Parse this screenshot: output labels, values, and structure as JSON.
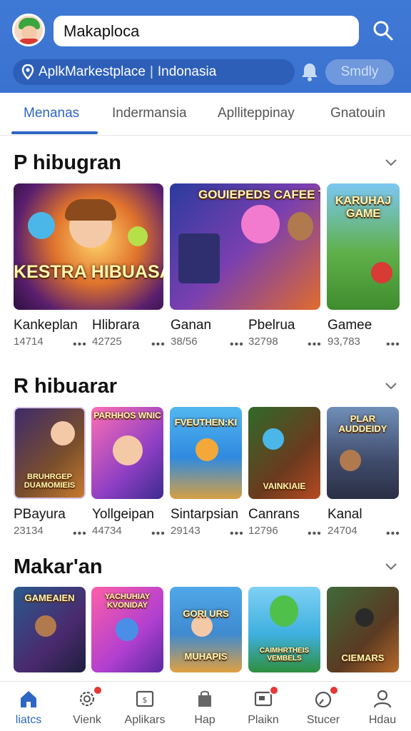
{
  "header": {
    "search_value": "Makaploca",
    "location_text": "AplkMarkestplace",
    "region_text": "Indonasia",
    "action_button": "Smdly",
    "colors": {
      "header_bg": "#3a72cf",
      "accent": "#2d66c4"
    }
  },
  "tabs": [
    {
      "label": "Menanas",
      "active": true
    },
    {
      "label": "Indermansia",
      "active": false
    },
    {
      "label": "Aplliteppinay",
      "active": false
    },
    {
      "label": "Gnatouin",
      "active": false
    }
  ],
  "sections": [
    {
      "title": "P hibugran",
      "cards": [
        {
          "name": "Kankeplan",
          "count": "14714",
          "art": "KESTRA HIBUASA"
        },
        {
          "name": "Hlibrara",
          "count": "42725",
          "art": ""
        },
        {
          "name": "Ganan",
          "count": "38/56",
          "art": "GOUIEPEDS CAFEE TAIONARN"
        },
        {
          "name": "Pbelrua",
          "count": "32798",
          "art": ""
        },
        {
          "name": "Gamee",
          "count": "93,783",
          "art": "KARUHAJ GAME"
        }
      ]
    },
    {
      "title": "R hibuarar",
      "cards": [
        {
          "name": "PBayura",
          "count": "23134",
          "art": "BRUHRGEP DUAMOMIEIS"
        },
        {
          "name": "Yollgeipan",
          "count": "44734",
          "art": "PARHHOS WNIC"
        },
        {
          "name": "Sintarpsian",
          "count": "29143",
          "art": "FVEUTHEN:KI"
        },
        {
          "name": "Canrans",
          "count": "12796",
          "art": "VAINKIAIE"
        },
        {
          "name": "Kanal",
          "count": "24704",
          "art": "PLAR AUDDEIDY"
        }
      ]
    },
    {
      "title": "Makar'an",
      "cards": [
        {
          "art": "GAMEAIEN"
        },
        {
          "art": "YACHUHIAY KVONIDAY"
        },
        {
          "art": "GORI URS MUHAPIS"
        },
        {
          "art": "CAIMHRTHEIS VEMBELS"
        },
        {
          "art": "CIEMARS"
        }
      ]
    }
  ],
  "bottom_nav": [
    {
      "label": "liatcs",
      "icon": "home-icon",
      "active": true,
      "badge": false
    },
    {
      "label": "Vienk",
      "icon": "gear-icon",
      "active": false,
      "badge": true
    },
    {
      "label": "Aplikars",
      "icon": "apps-box-icon",
      "active": false,
      "badge": false
    },
    {
      "label": "Hap",
      "icon": "bag-icon",
      "active": false,
      "badge": false
    },
    {
      "label": "Plaikn",
      "icon": "message-icon",
      "active": false,
      "badge": true
    },
    {
      "label": "Stucer",
      "icon": "gauge-icon",
      "active": false,
      "badge": true
    },
    {
      "label": "Hdau",
      "icon": "profile-icon",
      "active": false,
      "badge": false
    }
  ]
}
